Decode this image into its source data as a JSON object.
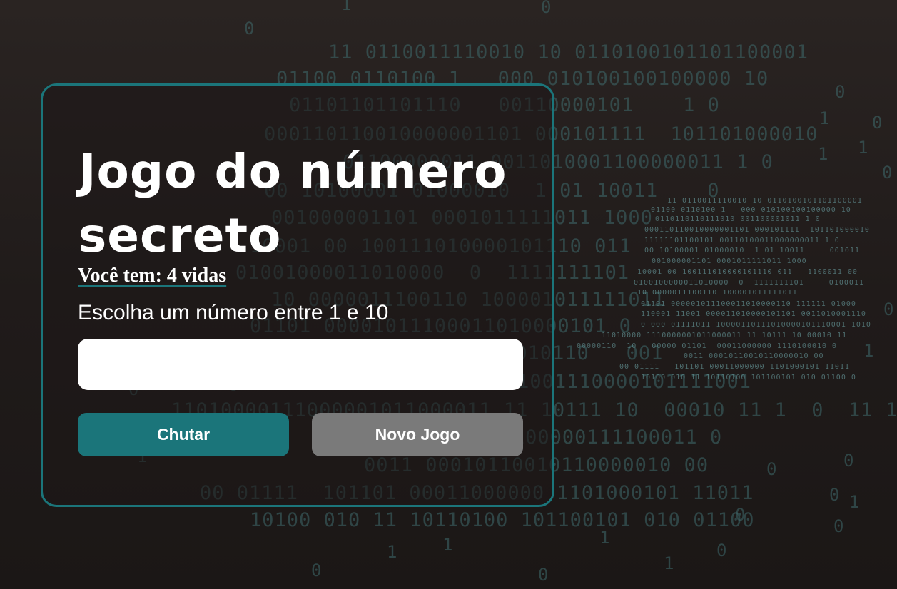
{
  "game": {
    "title": "Jogo do número secreto",
    "lives_text": "Você tem: 4 vidas",
    "prompt_text": "Escolha um número entre 1 e 10",
    "input": {
      "value": "",
      "placeholder": ""
    },
    "buttons": {
      "guess_label": "Chutar",
      "new_game_label": "Novo Jogo"
    }
  },
  "colors": {
    "accent": "#1b757a",
    "secondary_button": "#7a7a7a",
    "background": "#221d1c",
    "text": "#ffffff"
  }
}
